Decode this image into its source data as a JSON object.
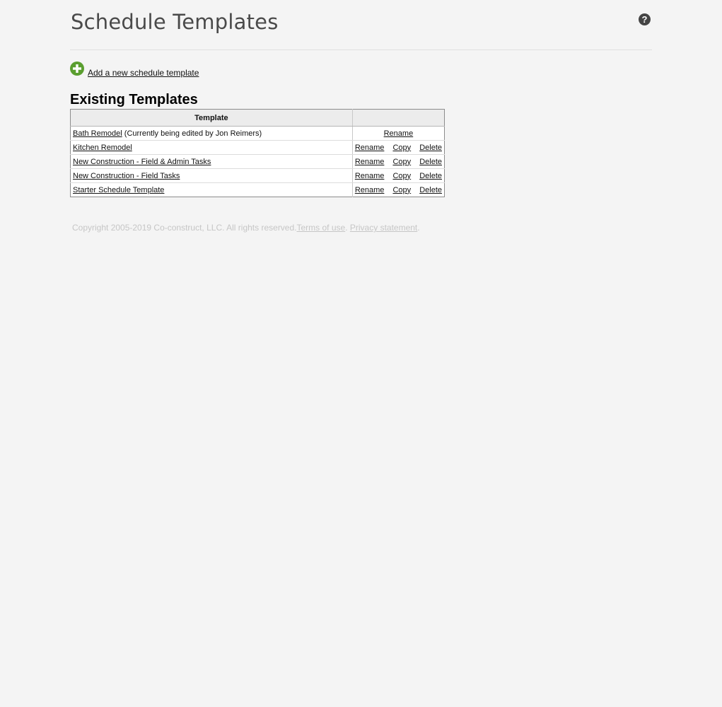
{
  "page": {
    "title": "Schedule Templates",
    "help_icon": "question-mark-icon"
  },
  "add_template": {
    "icon": "plus-circle-icon",
    "icon_color": "#5a9e2f",
    "label": "Add a new schedule template"
  },
  "existing": {
    "heading": "Existing Templates",
    "columns": [
      "Template",
      ""
    ],
    "rows": [
      {
        "name": "Bath Remodel",
        "note": " (Currently being edited by Jon Reimers)",
        "actions": [
          "Rename"
        ]
      },
      {
        "name": "Kitchen Remodel",
        "note": "",
        "actions": [
          "Rename",
          "Copy",
          "Delete"
        ]
      },
      {
        "name": "New Construction - Field & Admin Tasks",
        "note": "",
        "actions": [
          "Rename",
          "Copy",
          "Delete"
        ]
      },
      {
        "name": "New Construction - Field Tasks",
        "note": "",
        "actions": [
          "Rename",
          "Copy",
          "Delete"
        ]
      },
      {
        "name": "Starter Schedule Template",
        "note": "",
        "actions": [
          "Rename",
          "Copy",
          "Delete"
        ]
      }
    ]
  },
  "footer": {
    "copyright": "Copyright 2005-2019 Co-construct, LLC. All rights reserved.",
    "terms": "Terms of use",
    "separator": ".",
    "separator_space": " ",
    "privacy": "Privacy statement",
    "end": "."
  }
}
